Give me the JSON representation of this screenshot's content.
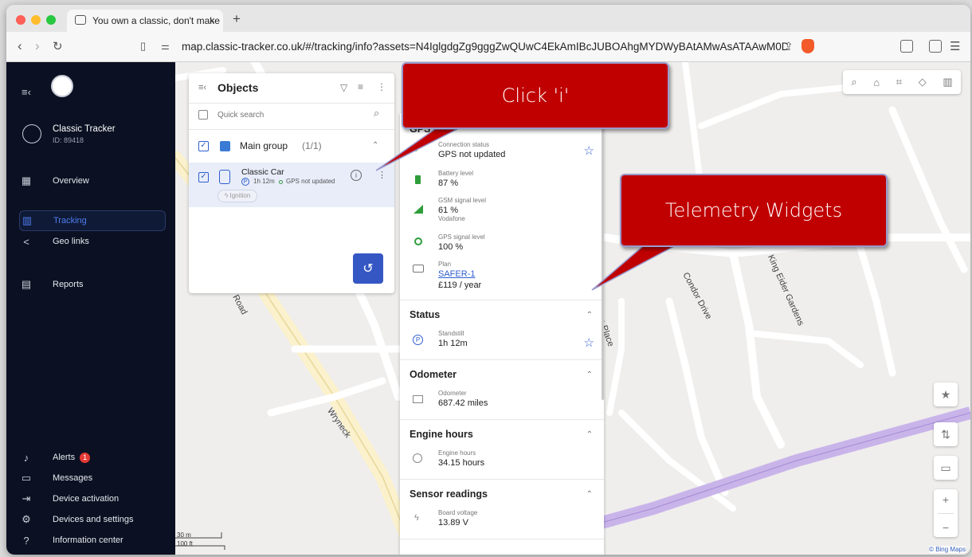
{
  "browser": {
    "tab_title": "You own a classic, don't make",
    "tab_close": "×",
    "new_tab": "+",
    "url": "map.classic-tracker.co.uk/#/tracking/info?assets=N4IglgdgZg9gggZwQUwC4EkAmIBcJUBOAhgMYDWyBAtAMwAsATAAwM0DslANCEUmg..."
  },
  "sidebar": {
    "account_name": "Classic Tracker",
    "account_id": "ID: 89418",
    "items": [
      {
        "label": "Overview",
        "icon": "grid-icon"
      },
      {
        "label": "Tracking",
        "icon": "map-icon"
      },
      {
        "label": "Geo links",
        "icon": "share-icon"
      },
      {
        "label": "Reports",
        "icon": "chart-icon"
      }
    ],
    "bottom_items": [
      {
        "label": "Alerts",
        "icon": "bell-icon",
        "badge": "1"
      },
      {
        "label": "Messages",
        "icon": "message-icon"
      },
      {
        "label": "Device activation",
        "icon": "login-icon"
      },
      {
        "label": "Devices and settings",
        "icon": "cog-icon"
      },
      {
        "label": "Information center",
        "icon": "help-icon"
      }
    ]
  },
  "objects_panel": {
    "title": "Objects",
    "search_placeholder": "Quick search",
    "group_label": "Main group",
    "group_count": "(1/1)",
    "car_name": "Classic Car",
    "car_duration": "1h 12m",
    "car_gps_status": "GPS not updated",
    "ignition_label": "Ignition"
  },
  "info_panel": {
    "gps_section_title": "GPS de",
    "gps_rows": [
      {
        "label": "Connection status",
        "value": "GPS not updated"
      },
      {
        "label": "Battery level",
        "value": "87 %"
      },
      {
        "label": "GSM signal level",
        "value": "61 %",
        "extra": "Vodafone"
      },
      {
        "label": "GPS signal level",
        "value": "100 %"
      },
      {
        "label": "Plan",
        "link": "SAFER-1",
        "extra": "£119 / year"
      }
    ],
    "sections": [
      {
        "title": "Status",
        "label": "Standstill",
        "value": "1h 12m"
      },
      {
        "title": "Odometer",
        "label": "Odometer",
        "value": "687.42 miles"
      },
      {
        "title": "Engine hours",
        "label": "Engine hours",
        "value": "34.15 hours"
      },
      {
        "title": "Sensor readings",
        "label": "Board voltage",
        "value": "13.89 V"
      }
    ]
  },
  "callouts": {
    "click_i": "Click 'i'",
    "telemetry": "Telemetry Widgets"
  },
  "map": {
    "streets": [
      "Condor Drive",
      "King Eider Gardens",
      "Wryneck",
      "Road",
      "n Place"
    ],
    "scale_m": "30 m",
    "scale_ft": "100 ft",
    "attribution": "© Bing Maps"
  },
  "colors": {
    "sidebar_bg": "#0b1122",
    "accent": "#4f7cf0",
    "callout_red": "#c00000",
    "cycle_path": "#c9b4ea"
  }
}
